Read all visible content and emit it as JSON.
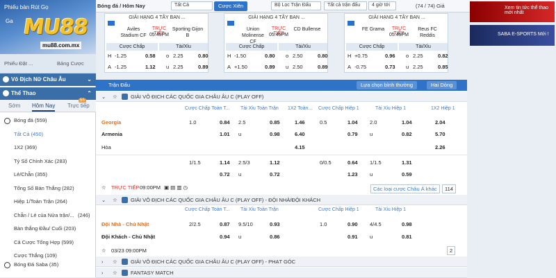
{
  "left": {
    "brand": {
      "logo": "MU88",
      "url": "mu88.com.mx",
      "banner1": "Phiếu bàn Rút Gọ",
      "banner2": "Ga"
    },
    "betslip": {
      "a": "Phiếu Đặt ...",
      "b": "Bảng Cược"
    },
    "section1": "Vô Địch Nữ Châu Âu",
    "section2": "Thể Thao",
    "tabs": [
      "Sớm",
      "Hôm Nay",
      "Trực tiếp"
    ],
    "live_count": "55",
    "sports": [
      {
        "label": "Bóng đá",
        "count": "(559)"
      },
      {
        "label": "Tất Cả",
        "count": "(450)"
      },
      {
        "label": "1X2",
        "count": "(369)"
      },
      {
        "label": "Tỷ Số Chính Xác",
        "count": "(283)"
      },
      {
        "label": "Lẻ/Chẵn",
        "count": "(355)"
      },
      {
        "label": "Tổng Số Bàn Thắng",
        "count": "(282)"
      },
      {
        "label": "Hiệp 1/Toàn Trận",
        "count": "(264)"
      },
      {
        "label": "Chẵn / Lẻ của Nửa trận/...",
        "count": "(246)"
      },
      {
        "label": "Bàn thắng Đầu/ Cuối",
        "count": "(203)"
      },
      {
        "label": "Cả Cược Tổng Hợp",
        "count": "(599)"
      },
      {
        "label": "Cược Thắng",
        "count": "(109)"
      },
      {
        "label": "Bóng Đá Saba",
        "count": "(35)"
      }
    ]
  },
  "topbar": {
    "sport": "Bóng đá / Hôm Nay",
    "filter": "Tất Cả",
    "view_btn": "Cược Xiên",
    "match_filter": "Bộ Lọc Trận Đấu",
    "all_matches": "Tất cả trận đấu",
    "time": "4 giờ tới",
    "counter": "(74 / 74) Giả"
  },
  "cards": [
    {
      "league": "GIẢI HẠNG 4 TÂY BAN ...",
      "home": "Aviles Stadium CF",
      "away": "Sporting Gijon B",
      "live": "TRỰC TIẾP",
      "time": "05:45PM",
      "h1": "Cược Chấp",
      "h2": "Tài/Xỉu",
      "r1": [
        "H",
        "-1.25",
        "0.58",
        "o",
        "2.25",
        "0.80"
      ],
      "r2": [
        "A",
        "-1.25",
        "1.12",
        "u",
        "2.25",
        "0.89"
      ]
    },
    {
      "league": "GIẢI HẠNG 4 TÂY BAN ...",
      "home": "Union Molinense CF",
      "away": "CD Bullense",
      "live": "TRỰC TIẾP",
      "time": "05:45PM",
      "h1": "Cược Chấp",
      "h2": "Tài/Xỉu",
      "r1": [
        "H",
        "-1.50",
        "0.80",
        "o",
        "2.50",
        "0.80"
      ],
      "r2": [
        "A",
        "+1.50",
        "0.89",
        "u",
        "2.50",
        "0.89"
      ]
    },
    {
      "league": "GIẢI HẠNG 4 TÂY BAN ...",
      "home": "FE Grama",
      "away": "Reus FC Reddis",
      "live": "TRỰC TIẾP",
      "time": "05:45PM",
      "h1": "Cược Chấp",
      "h2": "Tài/Xỉu",
      "r1": [
        "H",
        "+0.75",
        "0.96",
        "o",
        "2.25",
        "0.82"
      ],
      "r2": [
        "A",
        "-0.75",
        "0.73",
        "u",
        "2.25",
        "0.85"
      ]
    }
  ],
  "ads": {
    "a1": "Xem tin tức thể thao mới nhất",
    "a2": "SABA E-SPORTS Mới !"
  },
  "main": {
    "title": "Trận Đấu",
    "sort": "Lựa chọn bình thường",
    "odds": "Hai Dòng",
    "league1": "GIẢI VÔ ĐỊCH CÁC QUỐC GIA CHÂU ÂU C (PLAY OFF)",
    "cols": [
      "Cược Chấp Toàn T...",
      "Tài Xỉu Toàn Trận",
      "1X2 Toàn...",
      "Cược Chấp Hiệp 1",
      "Tài Xỉu Hiệp 1",
      "1X2 Hiệp 1"
    ],
    "m1": {
      "home": "Georgia",
      "away": "Armenia",
      "draw": "Hòa",
      "r1": [
        "1.0",
        "0.84",
        "2.5",
        "0.85",
        "1.46",
        "0.5",
        "1.04",
        "2.0",
        "1.04",
        "2.04"
      ],
      "r2": [
        "",
        "1.01",
        "u",
        "0.98",
        "6.40",
        "",
        "0.79",
        "u",
        "0.82",
        "5.70"
      ],
      "r3": [
        "",
        "",
        "",
        "",
        "4.15",
        "",
        "",
        "",
        "",
        "2.26"
      ],
      "r4": [
        "1/1.5",
        "1.14",
        "2.5/3",
        "1.12",
        "",
        "0/0.5",
        "0.64",
        "1/1.5",
        "1.31",
        ""
      ],
      "r5": [
        "",
        "0.72",
        "u",
        "0.72",
        "",
        "",
        "1.23",
        "u",
        "0.59",
        ""
      ],
      "live": "TRỰC TIẾP",
      "time": "09:00PM",
      "more": "Các loại cược Châu Á khác",
      "count": "114"
    },
    "league2": "GIẢI VÔ ĐỊCH CÁC QUỐC GIA CHÂU ÂU C (PLAY OFF) - ĐỘI NHÀ/ĐỘI KHÁCH",
    "cols2": [
      "Cược Chấp Toàn T...",
      "Tài Xỉu Toàn Trận",
      "Cược Chấp Hiệp 1",
      "Tài Xỉu Hiệp 1"
    ],
    "m2": {
      "home": "Đội Nhà - Chủ Nhật",
      "away": "Đội Khách - Chủ Nhật",
      "r1": [
        "2/2.5",
        "0.87",
        "9.5/10",
        "0.93",
        "1.0",
        "0.90",
        "4/4.5",
        "0.98"
      ],
      "r2": [
        "",
        "0.94",
        "u",
        "0.86",
        "",
        "0.91",
        "u",
        "0.81"
      ],
      "date": "03/23 09:00PM",
      "count": "2"
    },
    "league3": "GIẢI VÔ ĐỊCH CÁC QUỐC GIA CHÂU ÂU C (PLAY OFF) - PHẠT GÓC",
    "league4": "FANTASY MATCH"
  }
}
